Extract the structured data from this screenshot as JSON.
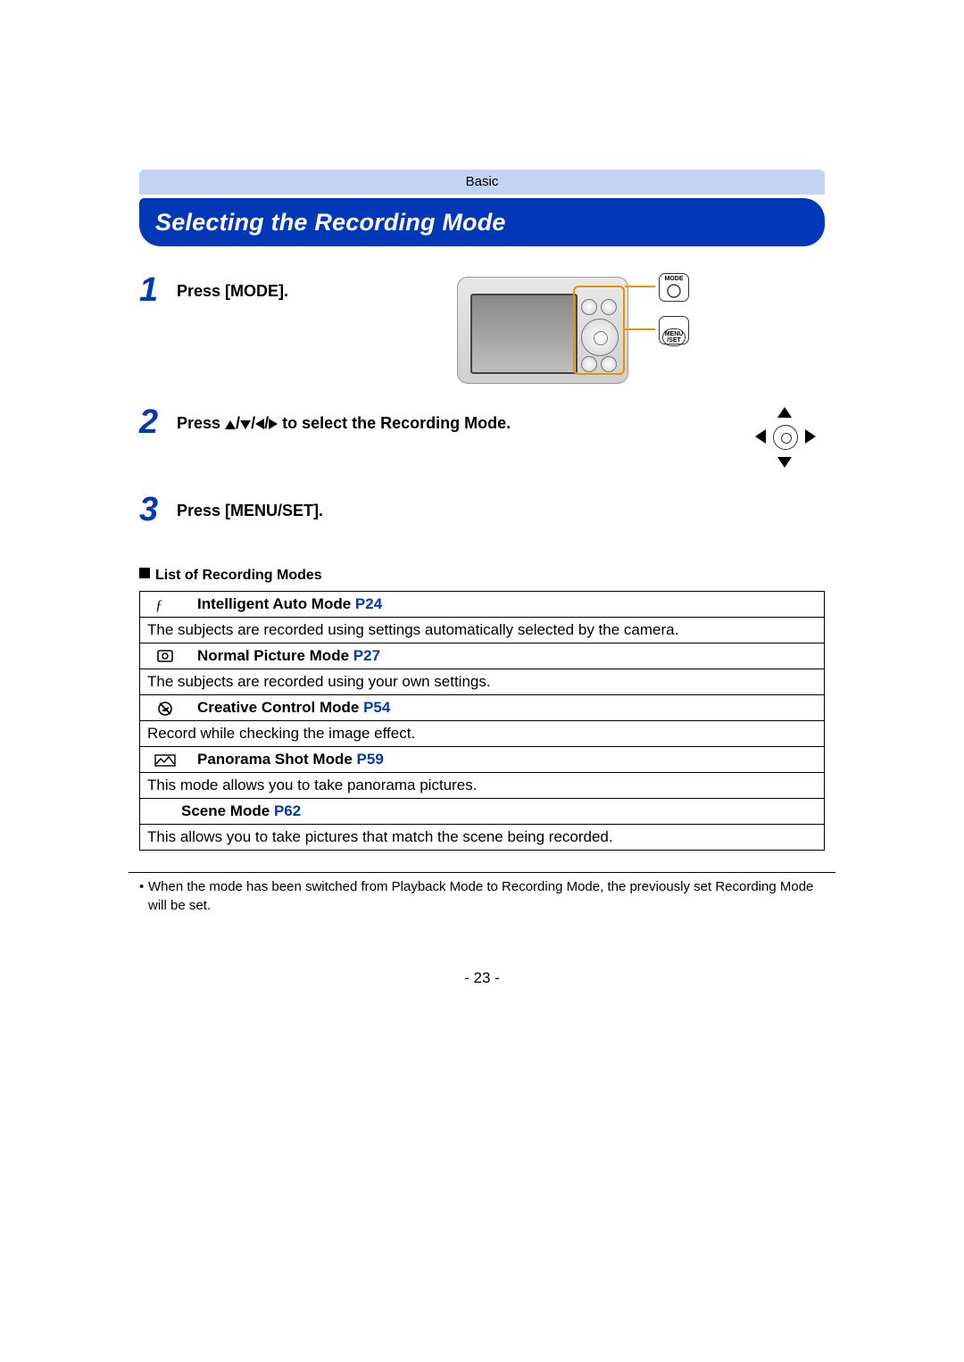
{
  "category": "Basic",
  "title": "Selecting the Recording Mode",
  "steps": {
    "s1": {
      "num": "1",
      "text": "Press [MODE]."
    },
    "s2": {
      "num": "2",
      "prefix": "Press ",
      "suffix": " to select the Recording Mode."
    },
    "s3": {
      "num": "3",
      "text": "Press [MENU/SET]."
    }
  },
  "illustration": {
    "mode_label": "MODE",
    "menuset_top": "MENU",
    "menuset_bottom": "/SET"
  },
  "list_heading": "List of Recording Modes",
  "modes": [
    {
      "name": "Intelligent Auto Mode",
      "page": "P24",
      "desc": "The subjects are recorded using settings automatically selected by the camera."
    },
    {
      "name": "Normal Picture Mode",
      "page": "P27",
      "desc": "The subjects are recorded using your own settings."
    },
    {
      "name": "Creative Control Mode",
      "page": "P54",
      "desc": "Record while checking the image effect."
    },
    {
      "name": "Panorama Shot Mode",
      "page": "P59",
      "desc": "This mode allows you to take panorama pictures."
    },
    {
      "name": "Scene Mode",
      "page": "P62",
      "desc": "This allows you to take pictures that match the scene being recorded."
    }
  ],
  "footnote_bullet": "•",
  "footnote": "When the mode has been switched from Playback Mode to Recording Mode, the previously set Recording Mode will be set.",
  "page_number": "- 23 -"
}
